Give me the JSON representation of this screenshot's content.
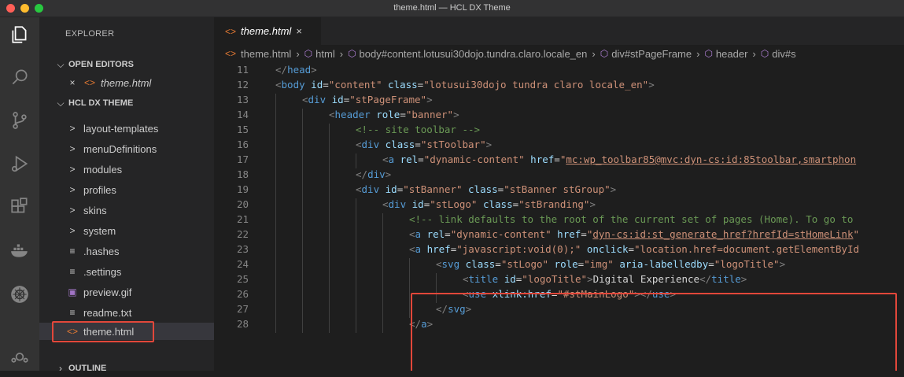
{
  "window": {
    "title": "theme.html — HCL DX Theme"
  },
  "colors": {
    "accent_highlight": "#e2473a",
    "tag": "#569cd6",
    "attr": "#9cdcfe",
    "string": "#ce9178",
    "comment": "#6a9955"
  },
  "activity_bar": [
    "explorer-icon",
    "search-icon",
    "source-control-icon",
    "run-debug-icon",
    "extensions-icon",
    "docker-icon",
    "kubernetes-icon"
  ],
  "sidebar": {
    "title": "EXPLORER",
    "open_editors": {
      "label": "OPEN EDITORS",
      "items": [
        {
          "close": "×",
          "icon": "<>",
          "name": "theme.html"
        }
      ]
    },
    "folder": {
      "label": "HCL DX THEME",
      "items": [
        {
          "chevron": ">",
          "name": "layout-templates"
        },
        {
          "chevron": ">",
          "name": "menuDefinitions"
        },
        {
          "chevron": ">",
          "name": "modules"
        },
        {
          "chevron": ">",
          "name": "profiles"
        },
        {
          "chevron": ">",
          "name": "skins"
        },
        {
          "chevron": ">",
          "name": "system"
        },
        {
          "icon": "≡",
          "name": ".hashes"
        },
        {
          "icon": "≡",
          "name": ".settings"
        },
        {
          "icon": "▣",
          "name": "preview.gif"
        },
        {
          "icon": "≡",
          "name": "readme.txt"
        },
        {
          "icon": "<>",
          "name": "theme.html"
        }
      ]
    },
    "outline": {
      "label": "OUTLINE"
    }
  },
  "editor": {
    "tab": {
      "icon": "<>",
      "label": "theme.html",
      "close": "×"
    },
    "breadcrumbs": [
      "theme.html",
      "html",
      "body#content.lotusui30dojo.tundra.claro.locale_en",
      "div#stPageFrame",
      "header",
      "div#s"
    ],
    "lines": [
      {
        "n": "11",
        "indent": 0,
        "segs": [
          [
            "p",
            "</"
          ],
          [
            "t",
            "head"
          ],
          [
            "p",
            ">"
          ]
        ]
      },
      {
        "n": "12",
        "indent": 0,
        "segs": [
          [
            "p",
            "<"
          ],
          [
            "t",
            "body "
          ],
          [
            "a",
            "id"
          ],
          [
            "x",
            "="
          ],
          [
            "s",
            "\"content\" "
          ],
          [
            "a",
            "class"
          ],
          [
            "x",
            "="
          ],
          [
            "s",
            "\"lotusui30dojo tundra claro locale_en\""
          ],
          [
            "p",
            ">"
          ]
        ]
      },
      {
        "n": "13",
        "indent": 1,
        "segs": [
          [
            "p",
            "<"
          ],
          [
            "t",
            "div "
          ],
          [
            "a",
            "id"
          ],
          [
            "x",
            "="
          ],
          [
            "s",
            "\"stPageFrame\""
          ],
          [
            "p",
            ">"
          ]
        ]
      },
      {
        "n": "14",
        "indent": 2,
        "segs": [
          [
            "p",
            "<"
          ],
          [
            "t",
            "header "
          ],
          [
            "a",
            "role"
          ],
          [
            "x",
            "="
          ],
          [
            "s",
            "\"banner\""
          ],
          [
            "p",
            ">"
          ]
        ]
      },
      {
        "n": "15",
        "indent": 3,
        "segs": [
          [
            "c",
            "<!-- site toolbar -->"
          ]
        ]
      },
      {
        "n": "16",
        "indent": 3,
        "segs": [
          [
            "p",
            "<"
          ],
          [
            "t",
            "div "
          ],
          [
            "a",
            "class"
          ],
          [
            "x",
            "="
          ],
          [
            "s",
            "\"stToolbar\""
          ],
          [
            "p",
            ">"
          ]
        ]
      },
      {
        "n": "17",
        "indent": 4,
        "segs": [
          [
            "p",
            "<"
          ],
          [
            "t",
            "a "
          ],
          [
            "a",
            "rel"
          ],
          [
            "x",
            "="
          ],
          [
            "s",
            "\"dynamic-content\" "
          ],
          [
            "a",
            "href"
          ],
          [
            "x",
            "="
          ],
          [
            "s",
            "\""
          ],
          [
            "su",
            "mc:wp_toolbar85@mvc:dyn-cs:id:85toolbar,smartphon"
          ]
        ]
      },
      {
        "n": "18",
        "indent": 3,
        "segs": [
          [
            "p",
            "</"
          ],
          [
            "t",
            "div"
          ],
          [
            "p",
            ">"
          ]
        ]
      },
      {
        "n": "19",
        "indent": 3,
        "segs": [
          [
            "p",
            "<"
          ],
          [
            "t",
            "div "
          ],
          [
            "a",
            "id"
          ],
          [
            "x",
            "="
          ],
          [
            "s",
            "\"stBanner\" "
          ],
          [
            "a",
            "class"
          ],
          [
            "x",
            "="
          ],
          [
            "s",
            "\"stBanner stGroup\""
          ],
          [
            "p",
            ">"
          ]
        ]
      },
      {
        "n": "20",
        "indent": 4,
        "segs": [
          [
            "p",
            "<"
          ],
          [
            "t",
            "div "
          ],
          [
            "a",
            "id"
          ],
          [
            "x",
            "="
          ],
          [
            "s",
            "\"stLogo\" "
          ],
          [
            "a",
            "class"
          ],
          [
            "x",
            "="
          ],
          [
            "s",
            "\"stBranding\""
          ],
          [
            "p",
            ">"
          ]
        ]
      },
      {
        "n": "21",
        "indent": 5,
        "segs": [
          [
            "c",
            "<!-- link defaults to the root of the current set of pages (Home). To go to"
          ]
        ]
      },
      {
        "n": "22",
        "indent": 5,
        "segs": [
          [
            "p",
            "<"
          ],
          [
            "t",
            "a "
          ],
          [
            "a",
            "rel"
          ],
          [
            "x",
            "="
          ],
          [
            "s",
            "\"dynamic-content\" "
          ],
          [
            "a",
            "href"
          ],
          [
            "x",
            "="
          ],
          [
            "s",
            "\""
          ],
          [
            "su",
            "dyn-cs:id:st_generate_href?hrefId=stHomeLink"
          ],
          [
            "s",
            "\""
          ]
        ]
      },
      {
        "n": "23",
        "indent": 5,
        "segs": [
          [
            "p",
            "<"
          ],
          [
            "t",
            "a "
          ],
          [
            "a",
            "href"
          ],
          [
            "x",
            "="
          ],
          [
            "s",
            "\"javascript:void(0);\" "
          ],
          [
            "a",
            "onclick"
          ],
          [
            "x",
            "="
          ],
          [
            "s",
            "\"location.href=document.getElementById"
          ]
        ]
      },
      {
        "n": "24",
        "indent": 6,
        "segs": [
          [
            "p",
            "<"
          ],
          [
            "t",
            "svg "
          ],
          [
            "a",
            "class"
          ],
          [
            "x",
            "="
          ],
          [
            "s",
            "\"stLogo\" "
          ],
          [
            "a",
            "role"
          ],
          [
            "x",
            "="
          ],
          [
            "s",
            "\"img\" "
          ],
          [
            "a",
            "aria-labelledby"
          ],
          [
            "x",
            "="
          ],
          [
            "s",
            "\"logoTitle\""
          ],
          [
            "p",
            ">"
          ]
        ]
      },
      {
        "n": "25",
        "indent": 7,
        "segs": [
          [
            "p",
            "<"
          ],
          [
            "t",
            "title "
          ],
          [
            "a",
            "id"
          ],
          [
            "x",
            "="
          ],
          [
            "s",
            "\"logoTitle\""
          ],
          [
            "p",
            ">"
          ],
          [
            "x",
            "Digital Experience"
          ],
          [
            "p",
            "</"
          ],
          [
            "t",
            "title"
          ],
          [
            "p",
            ">"
          ]
        ]
      },
      {
        "n": "26",
        "indent": 7,
        "segs": [
          [
            "p",
            "<"
          ],
          [
            "t",
            "use "
          ],
          [
            "a",
            "xlink:href"
          ],
          [
            "x",
            "="
          ],
          [
            "s",
            "\"#stMainLogo\""
          ],
          [
            "p",
            "></"
          ],
          [
            "t",
            "use"
          ],
          [
            "p",
            ">"
          ]
        ]
      },
      {
        "n": "27",
        "indent": 6,
        "segs": [
          [
            "p",
            "</"
          ],
          [
            "t",
            "svg"
          ],
          [
            "p",
            ">"
          ]
        ]
      },
      {
        "n": "28",
        "indent": 5,
        "segs": [
          [
            "p",
            "</"
          ],
          [
            "t",
            "a"
          ],
          [
            "p",
            ">"
          ]
        ]
      }
    ]
  }
}
